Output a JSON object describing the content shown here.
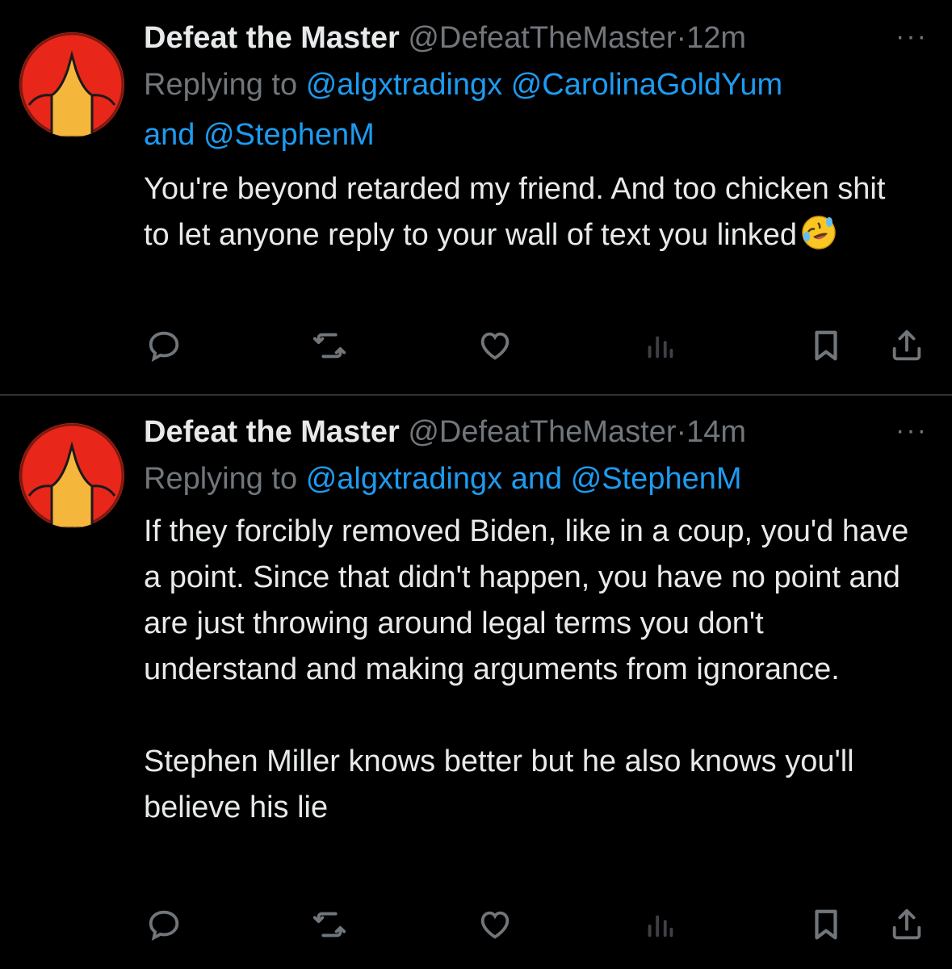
{
  "tweets": [
    {
      "display_name": "Defeat the Master",
      "handle": "@DefeatTheMaster",
      "separator": "·",
      "time": "12m",
      "more": "···",
      "replying_prefix": "Replying to",
      "replying_mentions": [
        "@algxtradingx",
        "@CarolinaGoldYum"
      ],
      "replying_joiner": "and",
      "replying_last": "@StephenM",
      "text": "You're beyond retarded my friend. And too chicken shit to let anyone reply to your wall of text you linked",
      "emoji": "rolling-on-floor-laughing",
      "actions": [
        "reply-icon",
        "retweet-icon",
        "like-icon",
        "views-icon",
        "bookmark-icon",
        "share-icon"
      ]
    },
    {
      "display_name": "Defeat the Master",
      "handle": "@DefeatTheMaster",
      "separator": "·",
      "time": "14m",
      "more": "···",
      "replying_prefix": "Replying to",
      "replying_first": "@algxtradingx",
      "replying_joiner": "and",
      "replying_last": "@StephenM",
      "text": "If they forcibly removed Biden, like in a coup, you'd have a point. Since that didn't happen, you have no point and are just throwing around legal terms you don't understand and making arguments from ignorance.\n\nStephen Miller knows better but he also knows you'll believe his lie",
      "actions": [
        "reply-icon",
        "retweet-icon",
        "like-icon",
        "views-icon",
        "bookmark-icon",
        "share-icon"
      ]
    }
  ],
  "colors": {
    "background": "#000000",
    "text": "#e7e9ea",
    "secondary": "#71767b",
    "link": "#1d9bf0",
    "divider": "#2f3336",
    "avatar_red": "#e8261a",
    "avatar_yellow": "#f5b73b"
  }
}
